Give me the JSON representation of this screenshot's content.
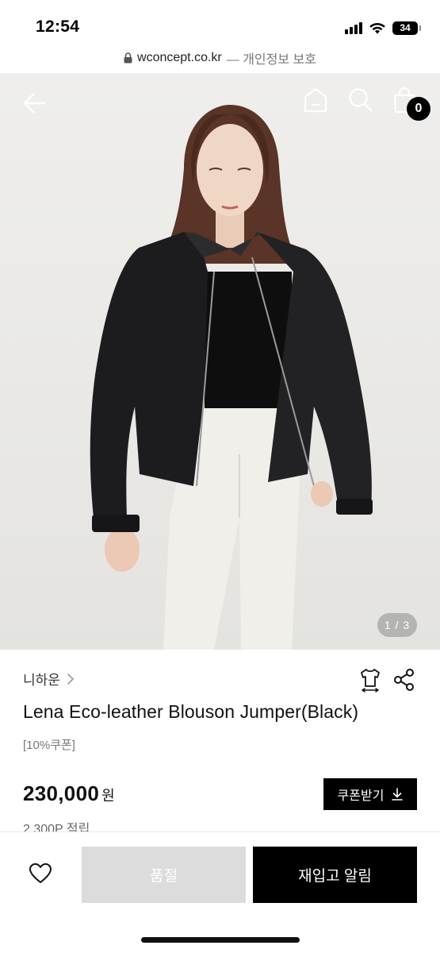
{
  "status_bar": {
    "time": "12:54",
    "battery": "34",
    "icons": [
      "signal-icon",
      "wifi-icon",
      "battery-icon"
    ]
  },
  "browser": {
    "domain": "wconcept.co.kr",
    "privacy": "— 개인정보 보호",
    "icons": [
      "lock-icon"
    ]
  },
  "header": {
    "icons": [
      "back-arrow-icon",
      "home-icon",
      "search-icon",
      "shopping-bag-icon"
    ],
    "cart_count": "0"
  },
  "gallery": {
    "indicator": "1 / 3"
  },
  "product": {
    "brand": "니하운",
    "title": "Lena Eco-leather Blouson Jumper(Black)",
    "coupon_tag": "[10%쿠폰]",
    "price": "230,000",
    "currency": "원",
    "points": "2,300P 적립",
    "icons": [
      "chevron-right-icon",
      "size-guide-shirt-icon",
      "share-icon"
    ]
  },
  "actions": {
    "coupon_button": "쿠폰받기",
    "soldout_button": "품절",
    "restock_button": "재입고 알림",
    "icons": [
      "download-icon",
      "heart-icon"
    ]
  },
  "colors": {
    "primary": "#000000",
    "disabled": "#dcdcdc",
    "text": "#111111",
    "muted": "#777777"
  }
}
